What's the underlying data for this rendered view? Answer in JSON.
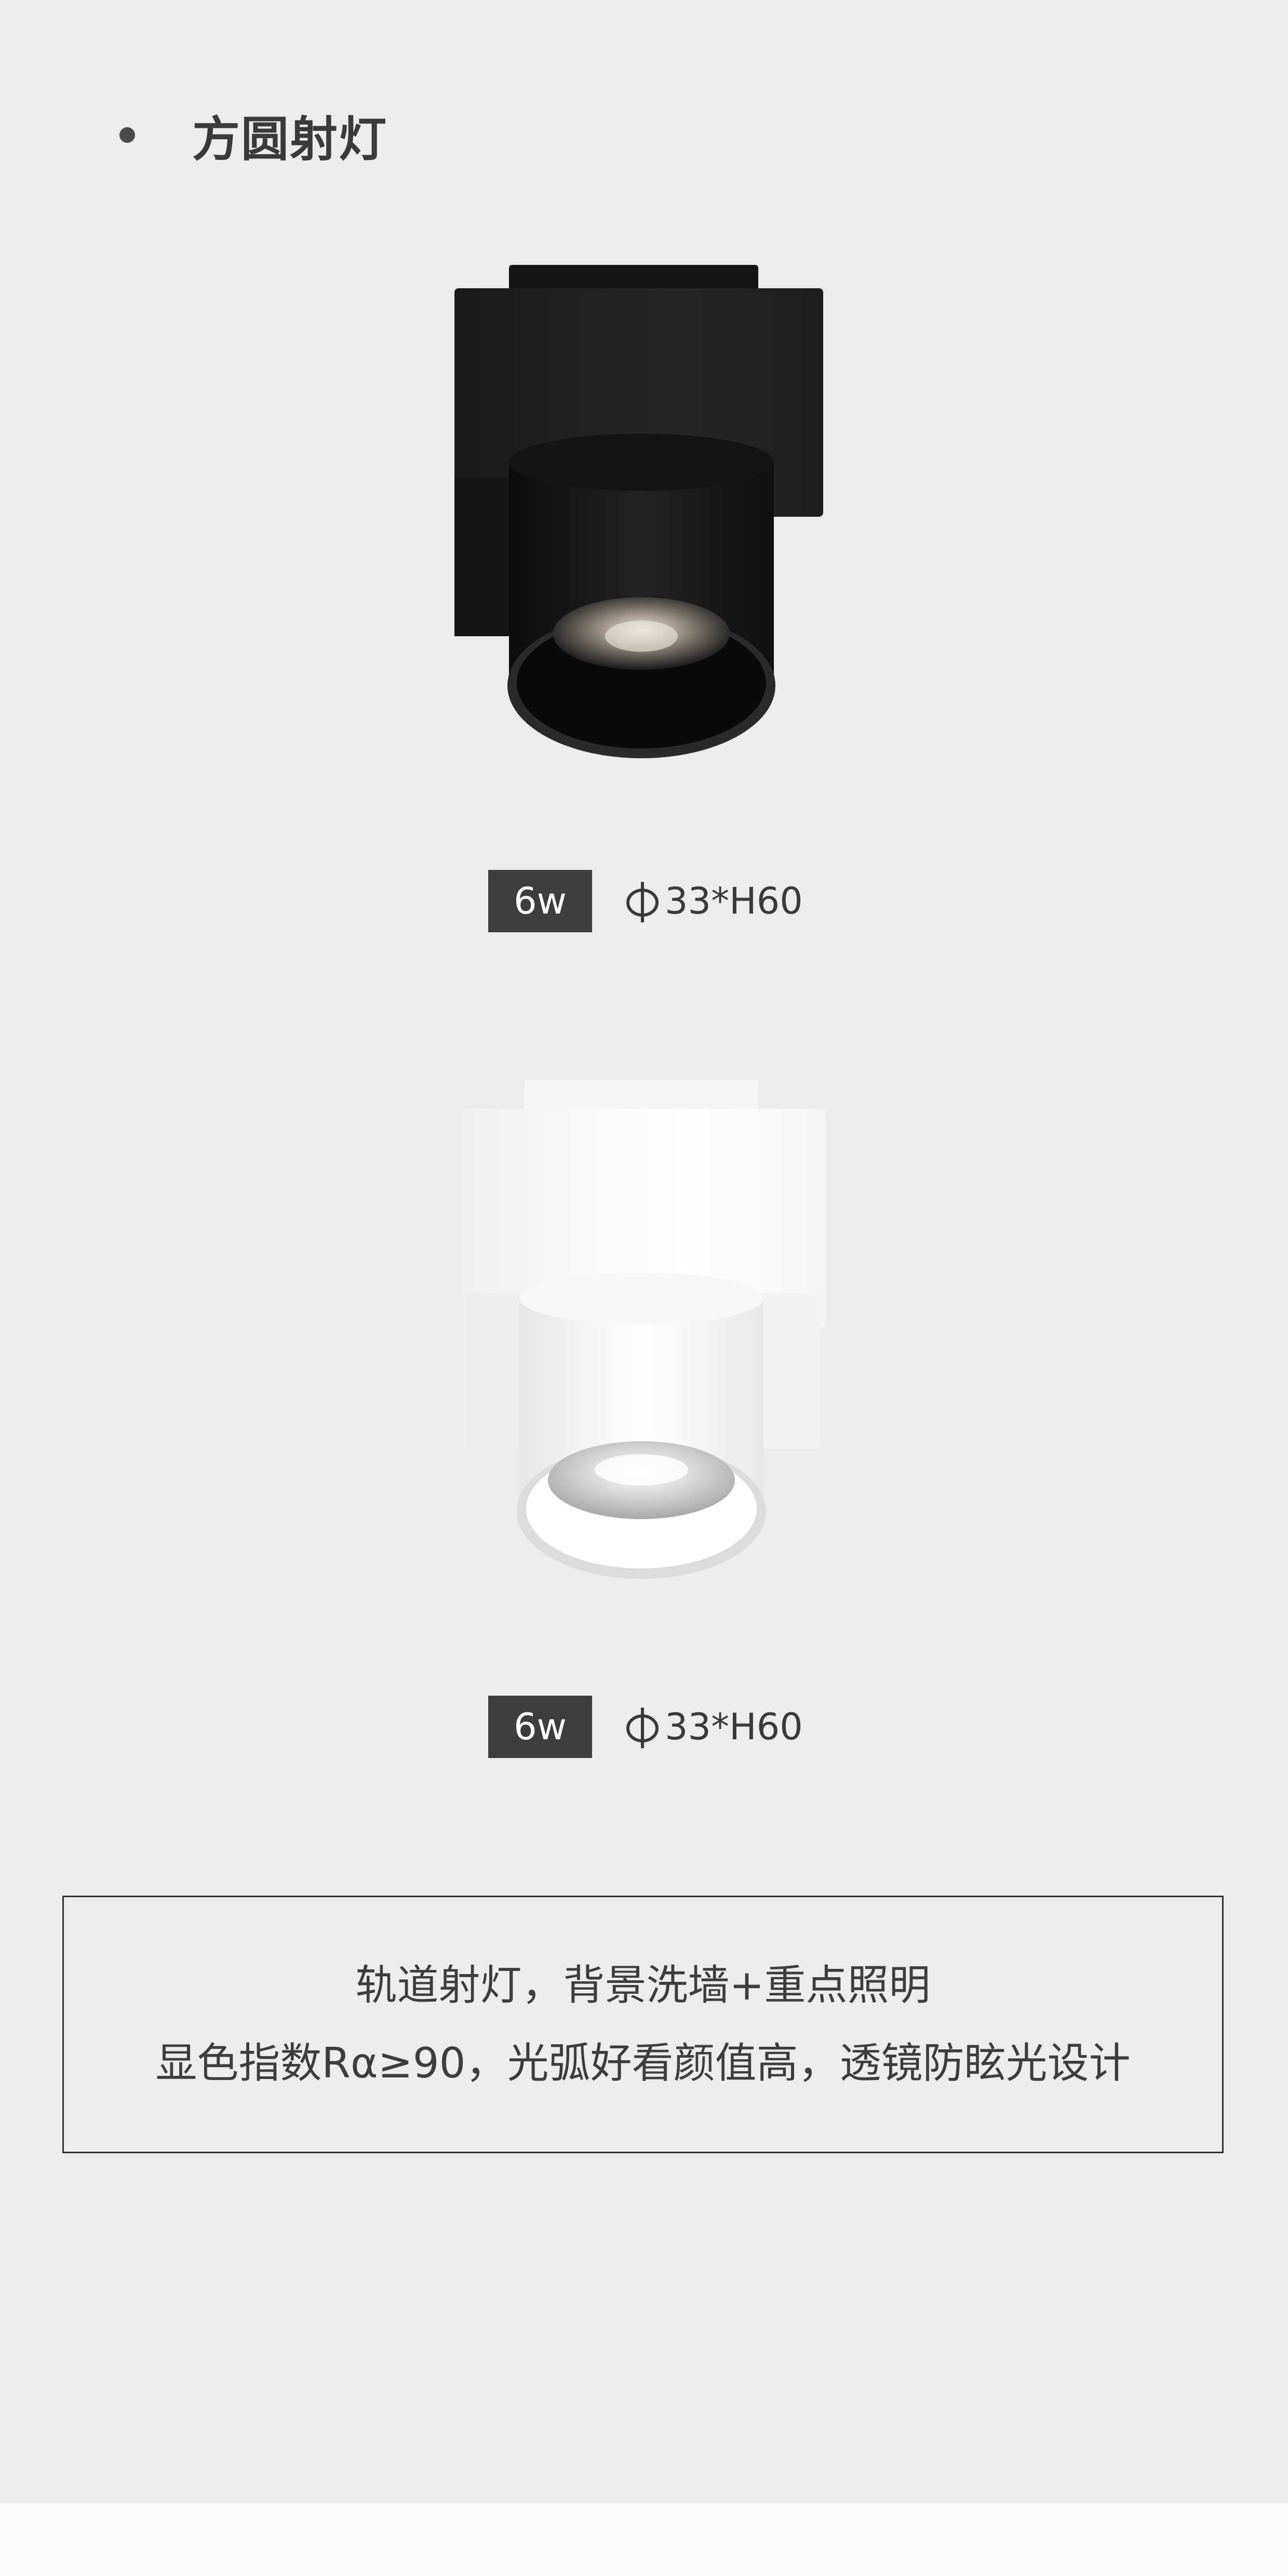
{
  "header": {
    "title": "方圆射灯"
  },
  "products": [
    {
      "color": "#1c1c1c",
      "variant": "black",
      "watt_label": "6w",
      "dimension_label": "33*H60"
    },
    {
      "color": "#f7f7f7",
      "variant": "white",
      "watt_label": "6w",
      "dimension_label": "33*H60"
    }
  ],
  "icons": {
    "bullet": "bullet-dot-icon",
    "diameter": "diameter-phi-icon"
  },
  "feature_box": {
    "line1": "轨道射灯，背景洗墙+重点照明",
    "line2": "显色指数Rα≥90，光弧好看颜值高，透镜防眩光设计"
  },
  "colors": {
    "background": "#ececec",
    "badge": "#3d3d3d",
    "text": "#3a3a3a"
  }
}
